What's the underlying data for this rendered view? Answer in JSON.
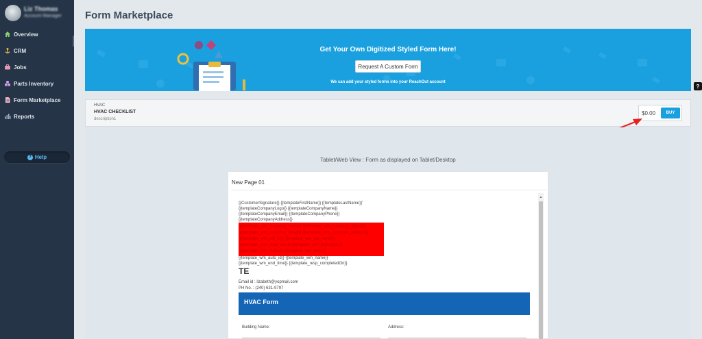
{
  "user": {
    "name": "Liz Thomas",
    "subtitle": "Account Manager"
  },
  "sidebar": {
    "items": [
      {
        "label": "Overview",
        "icon": "home-icon"
      },
      {
        "label": "CRM",
        "icon": "user-anchor-icon"
      },
      {
        "label": "Jobs",
        "icon": "briefcase-icon"
      },
      {
        "label": "Parts Inventory",
        "icon": "cubes-icon"
      },
      {
        "label": "Form Marketplace",
        "icon": "document-icon"
      },
      {
        "label": "Reports",
        "icon": "bar-chart-icon"
      }
    ],
    "help_label": "Help"
  },
  "page": {
    "title": "Form Marketplace"
  },
  "banner": {
    "heading": "Get Your Own Digitized Styled Form Here!",
    "button_label": "Request A Custom Form",
    "subtext": "We can add your styled forms into your ReachOut account"
  },
  "help_tab": "?",
  "product": {
    "category": "HVAC",
    "name": "HVAC CHECKLIST",
    "description": "description1",
    "price": "$0.00",
    "buy_label": "BUY"
  },
  "preview": {
    "view_label": "Tablet/Web View : Form as displayed on Tablet/Desktop",
    "page_title": "New Page 01",
    "template_lines": [
      "{{CustomerSignature}} {{templateFirstName}} {{templateLastName}}'",
      "{{templateCompanyLogo}} {{templateCompanyName}}",
      "{{templateCompanyEmail}} {{templateCompanyPhone}}",
      "{{templateCompanyAddress}}"
    ],
    "red_lines": [
      "{{template_wm_customer_name}} {{template_wm_customer_phone}}",
      "{{template_wm_customer_email}} {{template_wm_customer_address}}",
      "{{template_wm_job_id}} {{template_wm_job_name}}",
      "{{template_wm_start_time}} {{template_wm_technician}}",
      "{{template_wm_status}} {{template_wm_notes}}"
    ],
    "template_lines_2": [
      "{{template_wm_auto_id}} {{template_wm_name}}",
      "{{template_wm_end_time}} {{template_resp_completedOn}}"
    ],
    "company_abbr": "TE",
    "email_line": "Email id : lizabeth@yopmail.com",
    "phone_line": "PH No. : (240) 631-9797",
    "form_title": "HVAC Form",
    "fields": {
      "building_name": "Building Name:",
      "address": "Address:"
    }
  },
  "colors": {
    "sidebar": "#253447",
    "accent": "#1aa0df",
    "form_bar": "#1565b7",
    "red_block": "#ff0000"
  }
}
